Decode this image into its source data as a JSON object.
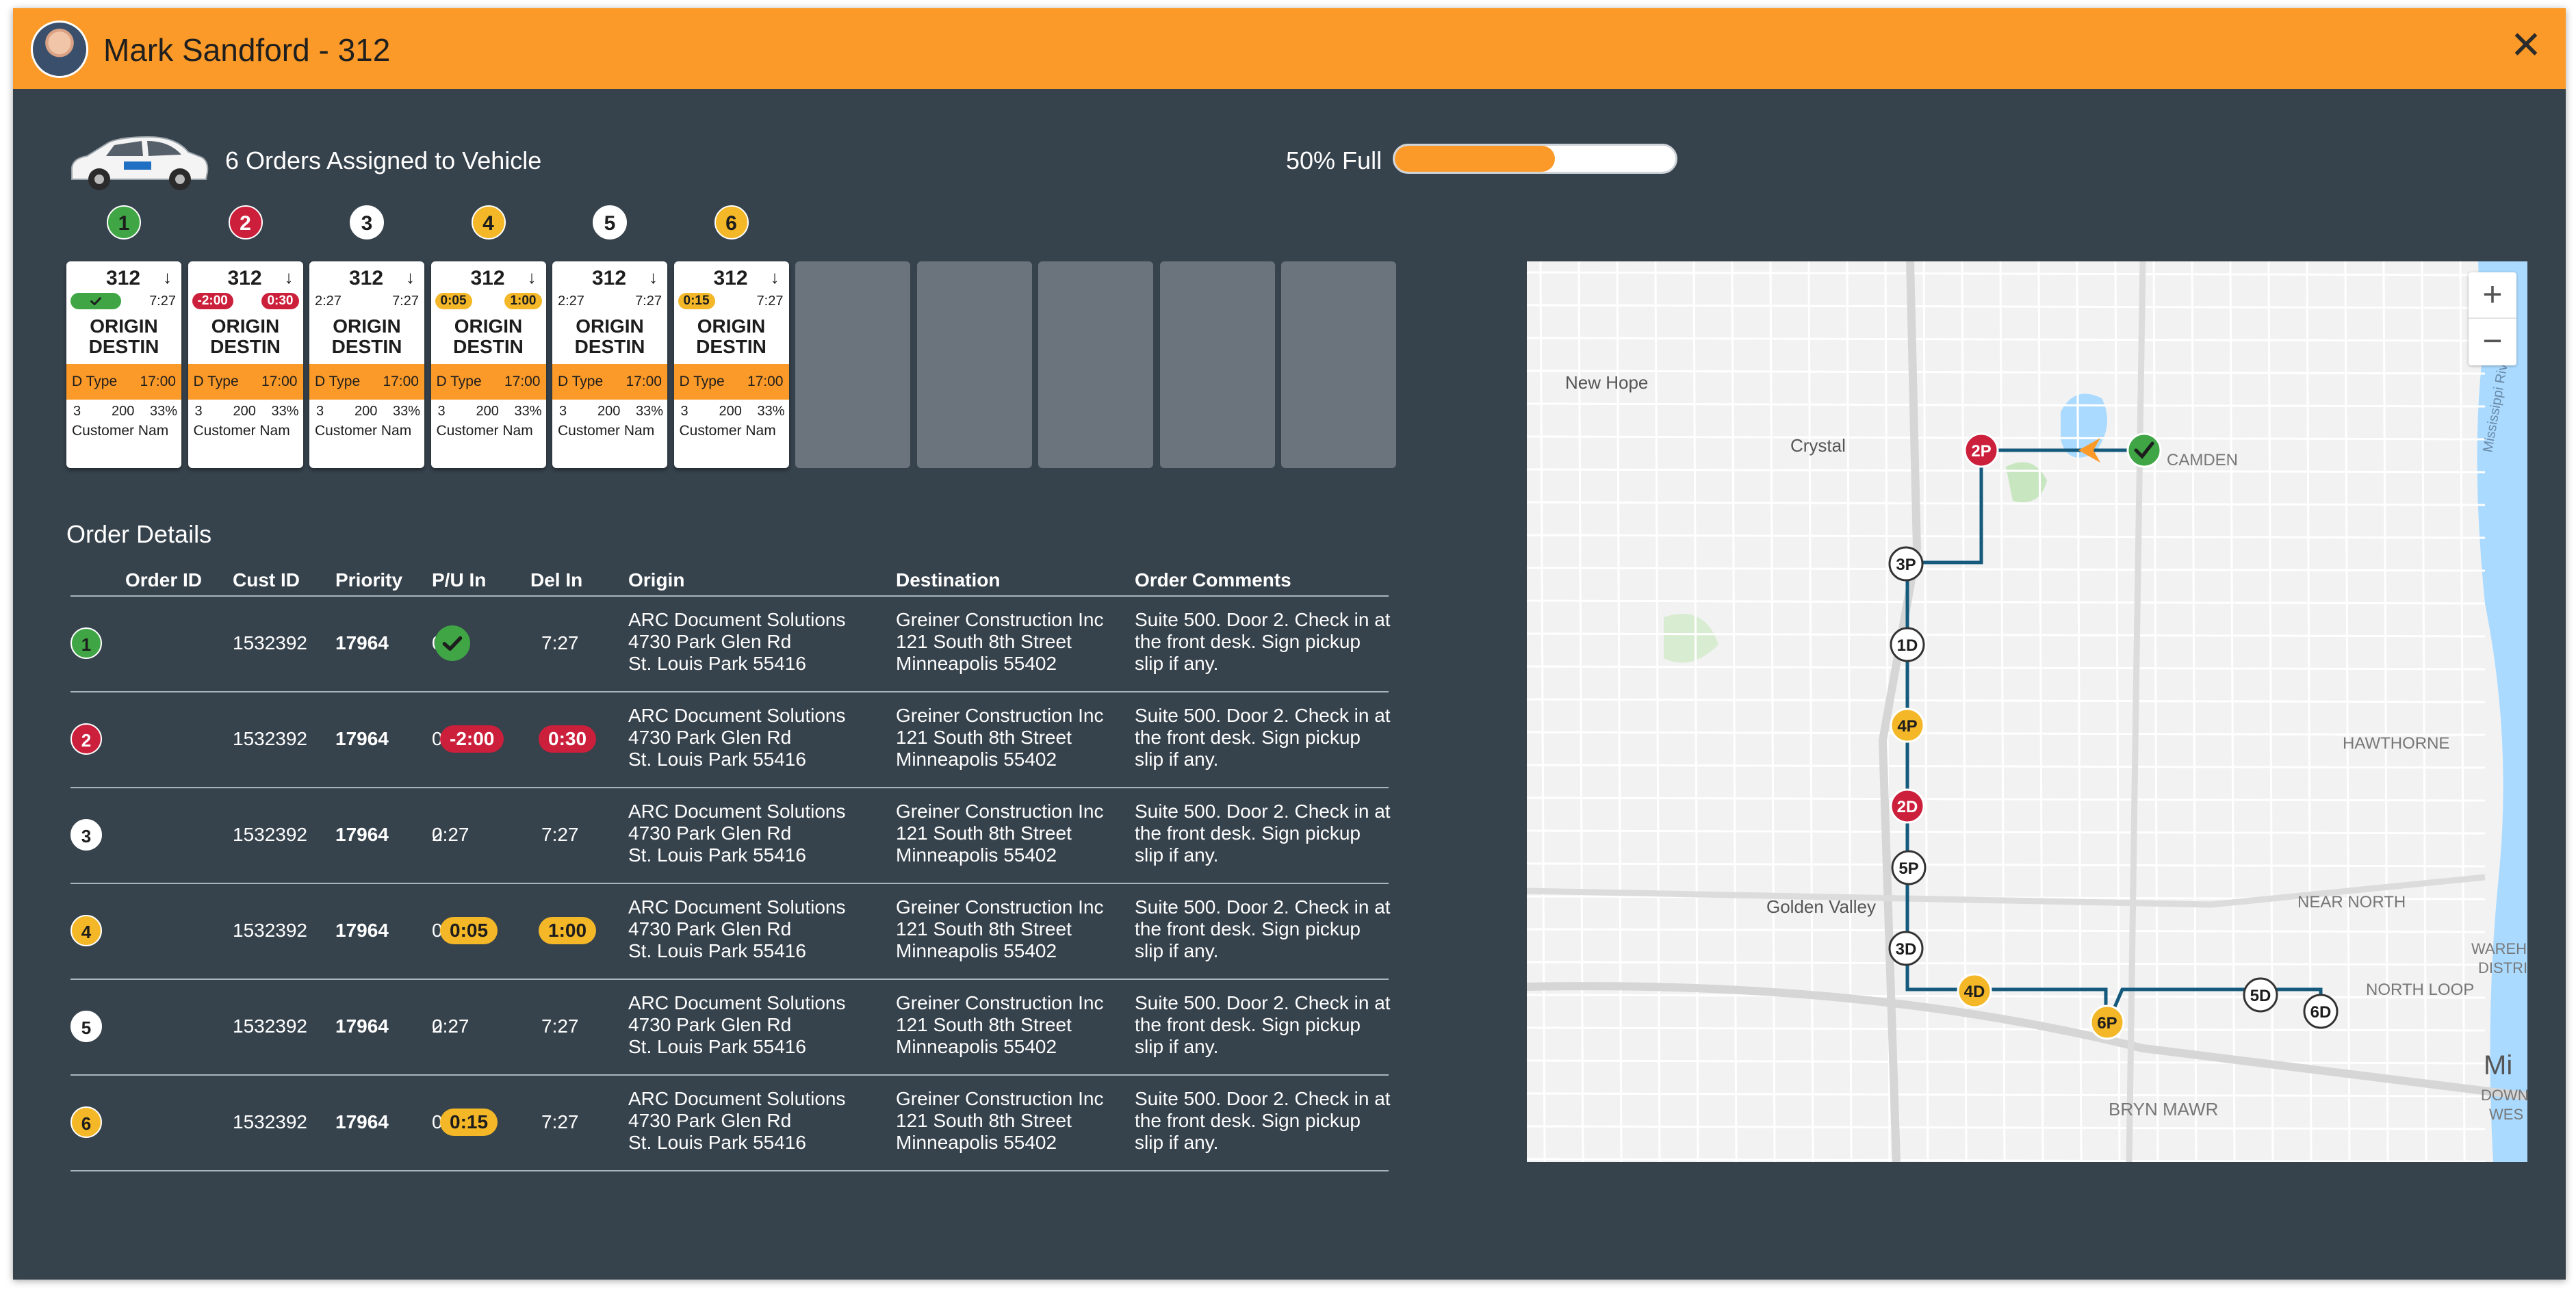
{
  "header": {
    "title": "Mark Sandford - 312",
    "close_icon": "close-icon"
  },
  "vehicle": {
    "orders_assigned": "6 Orders Assigned to Vehicle",
    "capacity_label": "50% Full",
    "capacity_fraction": 0.57
  },
  "colors": {
    "orange": "#fb9a28",
    "green": "#3fa545",
    "red": "#cc1f3b",
    "yellow": "#f3b727",
    "white": "#ffffff",
    "background": "#36424c",
    "route": "#155a7c"
  },
  "cards": [
    {
      "badge": "1",
      "color": "green",
      "num": "312",
      "left_kind": "check",
      "left": "",
      "right_kind": "plain",
      "right": "7:27",
      "origin": "ORIGIN",
      "destin": "DESTIN",
      "type": "D Type",
      "time": "17:00",
      "qty": "3",
      "weight": "200",
      "pct": "33%",
      "customer": "Customer Nam"
    },
    {
      "badge": "2",
      "color": "red",
      "num": "312",
      "left_kind": "red",
      "left": "-2:00",
      "right_kind": "red",
      "right": "0:30",
      "origin": "ORIGIN",
      "destin": "DESTIN",
      "type": "D Type",
      "time": "17:00",
      "qty": "3",
      "weight": "200",
      "pct": "33%",
      "customer": "Customer Nam"
    },
    {
      "badge": "3",
      "color": "white",
      "num": "312",
      "left_kind": "plain",
      "left": "2:27",
      "right_kind": "plain",
      "right": "7:27",
      "origin": "ORIGIN",
      "destin": "DESTIN",
      "type": "D Type",
      "time": "17:00",
      "qty": "3",
      "weight": "200",
      "pct": "33%",
      "customer": "Customer Nam"
    },
    {
      "badge": "4",
      "color": "yellow",
      "num": "312",
      "left_kind": "yellow",
      "left": "0:05",
      "right_kind": "yellow",
      "right": "1:00",
      "origin": "ORIGIN",
      "destin": "DESTIN",
      "type": "D Type",
      "time": "17:00",
      "qty": "3",
      "weight": "200",
      "pct": "33%",
      "customer": "Customer Nam"
    },
    {
      "badge": "5",
      "color": "white",
      "num": "312",
      "left_kind": "plain",
      "left": "2:27",
      "right_kind": "plain",
      "right": "7:27",
      "origin": "ORIGIN",
      "destin": "DESTIN",
      "type": "D Type",
      "time": "17:00",
      "qty": "3",
      "weight": "200",
      "pct": "33%",
      "customer": "Customer Nam"
    },
    {
      "badge": "6",
      "color": "yellow",
      "num": "312",
      "left_kind": "yellow",
      "left": "0:15",
      "right_kind": "plain",
      "right": "7:27",
      "origin": "ORIGIN",
      "destin": "DESTIN",
      "type": "D Type",
      "time": "17:00",
      "qty": "3",
      "weight": "200",
      "pct": "33%",
      "customer": "Customer Nam"
    }
  ],
  "empty_slots": 5,
  "order_details": {
    "title": "Order Details",
    "columns": [
      "Order ID",
      "Cust ID",
      "Priority",
      "P/U In",
      "Del In",
      "Origin",
      "Destination",
      "Order Comments"
    ],
    "rows": [
      {
        "num": "1",
        "color": "green",
        "order_id": "1532392",
        "cust_id": "17964",
        "priority": "0",
        "pu_kind": "check",
        "pu": "",
        "del_kind": "plain",
        "del": "7:27",
        "origin": [
          "ARC Document Solutions",
          "4730 Park Glen Rd",
          "St. Louis Park 55416"
        ],
        "destination": [
          "Greiner Construction Inc",
          "121 South 8th Street",
          "Minneapolis 55402"
        ],
        "comments": [
          "Suite 500. Door 2. Check in at",
          "the front desk. Sign pickup",
          "slip if any."
        ]
      },
      {
        "num": "2",
        "color": "red",
        "order_id": "1532392",
        "cust_id": "17964",
        "priority": "0",
        "pu_kind": "red",
        "pu": "-2:00",
        "del_kind": "red",
        "del": "0:30",
        "origin": [
          "ARC Document Solutions",
          "4730 Park Glen Rd",
          "St. Louis Park 55416"
        ],
        "destination": [
          "Greiner Construction Inc",
          "121 South 8th Street",
          "Minneapolis 55402"
        ],
        "comments": [
          "Suite 500. Door 2. Check in at",
          "the front desk. Sign pickup",
          "slip if any."
        ]
      },
      {
        "num": "3",
        "color": "white",
        "order_id": "1532392",
        "cust_id": "17964",
        "priority": "0",
        "pu_kind": "plain",
        "pu": "2:27",
        "del_kind": "plain",
        "del": "7:27",
        "origin": [
          "ARC Document Solutions",
          "4730 Park Glen Rd",
          "St. Louis Park 55416"
        ],
        "destination": [
          "Greiner Construction Inc",
          "121 South 8th Street",
          "Minneapolis 55402"
        ],
        "comments": [
          "Suite 500. Door 2. Check in at",
          "the front desk. Sign pickup",
          "slip if any."
        ]
      },
      {
        "num": "4",
        "color": "yellow",
        "order_id": "1532392",
        "cust_id": "17964",
        "priority": "0",
        "pu_kind": "yellow",
        "pu": "0:05",
        "del_kind": "yellow",
        "del": "1:00",
        "origin": [
          "ARC Document Solutions",
          "4730 Park Glen Rd",
          "St. Louis Park 55416"
        ],
        "destination": [
          "Greiner Construction Inc",
          "121 South 8th Street",
          "Minneapolis 55402"
        ],
        "comments": [
          "Suite 500. Door 2. Check in at",
          "the front desk. Sign pickup",
          "slip if any."
        ]
      },
      {
        "num": "5",
        "color": "white",
        "order_id": "1532392",
        "cust_id": "17964",
        "priority": "0",
        "pu_kind": "plain",
        "pu": "2:27",
        "del_kind": "plain",
        "del": "7:27",
        "origin": [
          "ARC Document Solutions",
          "4730 Park Glen Rd",
          "St. Louis Park 55416"
        ],
        "destination": [
          "Greiner Construction Inc",
          "121 South 8th Street",
          "Minneapolis 55402"
        ],
        "comments": [
          "Suite 500. Door 2. Check in at",
          "the front desk. Sign pickup",
          "slip if any."
        ]
      },
      {
        "num": "6",
        "color": "yellow",
        "order_id": "1532392",
        "cust_id": "17964",
        "priority": "0",
        "pu_kind": "yellow",
        "pu": "0:15",
        "del_kind": "plain",
        "del": "7:27",
        "origin": [
          "ARC Document Solutions",
          "4730 Park Glen Rd",
          "St. Louis Park 55416"
        ],
        "destination": [
          "Greiner Construction Inc",
          "121 South 8th Street",
          "Minneapolis 55402"
        ],
        "comments": [
          "Suite 500. Door 2. Check in at",
          "the front desk. Sign pickup",
          "slip if any."
        ]
      }
    ]
  },
  "map": {
    "zoom_in": "+",
    "zoom_out": "−",
    "labels": [
      {
        "text": "New Hope",
        "kind": "city"
      },
      {
        "text": "Crystal",
        "kind": "city"
      },
      {
        "text": "CAMDEN",
        "kind": "district"
      },
      {
        "text": "HAWTHORNE",
        "kind": "district"
      },
      {
        "text": "Golden Valley",
        "kind": "city"
      },
      {
        "text": "NEAR NORTH",
        "kind": "district"
      },
      {
        "text": "NORTH LOOP",
        "kind": "district"
      },
      {
        "text": "BRYN MAWR",
        "kind": "district"
      },
      {
        "text": "Mississippi River",
        "kind": "water"
      },
      {
        "text": "Mi",
        "kind": "city"
      },
      {
        "text": "DOWNTO",
        "kind": "district"
      },
      {
        "text": "WES",
        "kind": "district"
      },
      {
        "text": "WAREHO",
        "kind": "district"
      },
      {
        "text": "DISTRI",
        "kind": "district"
      }
    ],
    "stops": [
      {
        "label": "2P",
        "color": "red"
      },
      {
        "label": "3P",
        "color": "white"
      },
      {
        "label": "1D",
        "color": "white"
      },
      {
        "label": "4P",
        "color": "yellow"
      },
      {
        "label": "2D",
        "color": "red"
      },
      {
        "label": "5P",
        "color": "white"
      },
      {
        "label": "3D",
        "color": "white"
      },
      {
        "label": "4D",
        "color": "yellow"
      },
      {
        "label": "6P",
        "color": "yellow"
      },
      {
        "label": "5D",
        "color": "white"
      },
      {
        "label": "6D",
        "color": "white"
      }
    ]
  }
}
